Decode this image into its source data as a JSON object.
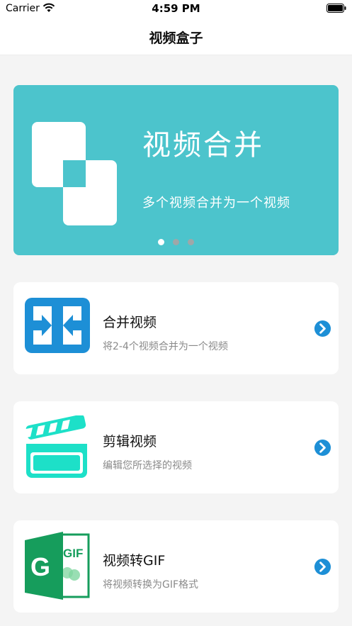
{
  "status_bar": {
    "carrier": "Carrier",
    "time": "4:59 PM"
  },
  "nav": {
    "title": "视频盒子"
  },
  "banner": {
    "title": "视频合并",
    "subtitle": "多个视频合并为一个视频",
    "page_index": 1,
    "page_count": 3
  },
  "cards": [
    {
      "title": "合并视频",
      "subtitle": "将2-4个视频合并为一个视频",
      "icon": "merge-icon"
    },
    {
      "title": "剪辑视频",
      "subtitle": "编辑您所选择的视频",
      "icon": "clapperboard-icon"
    },
    {
      "title": "视频转GIF",
      "subtitle": "将视频转换为GIF格式",
      "icon": "gif-convert-icon",
      "icon_text": "GIF",
      "icon_letter": "G"
    }
  ],
  "colors": {
    "banner": "#4cc4cc",
    "merge_blue": "#1d8fd6",
    "clapper_teal": "#1de0c8",
    "gif_green": "#169d5c",
    "arrow_blue": "#1d8fd6"
  }
}
